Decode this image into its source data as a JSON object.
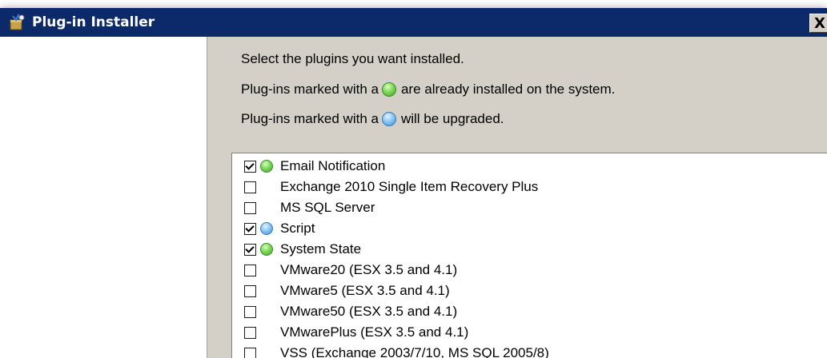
{
  "window": {
    "title": "Plug-in Installer",
    "close_label": "X",
    "title_bar_color": "#0c2a6a"
  },
  "instructions": {
    "line1": "Select the plugins you want installed.",
    "line2_before": "Plug-ins marked with a",
    "line2_after": "are already installed on the system.",
    "line3_before": "Plug-ins marked with a",
    "line3_after": "will be upgraded."
  },
  "plugins": [
    {
      "label": "Email Notification",
      "checked": true,
      "status": "installed"
    },
    {
      "label": "Exchange 2010 Single Item Recovery Plus",
      "checked": false,
      "status": "none"
    },
    {
      "label": "MS SQL Server",
      "checked": false,
      "status": "none"
    },
    {
      "label": "Script",
      "checked": true,
      "status": "upgrade"
    },
    {
      "label": "System State",
      "checked": true,
      "status": "installed"
    },
    {
      "label": "VMware20 (ESX 3.5 and 4.1)",
      "checked": false,
      "status": "none"
    },
    {
      "label": "VMware5 (ESX 3.5 and 4.1)",
      "checked": false,
      "status": "none"
    },
    {
      "label": "VMware50 (ESX 3.5 and 4.1)",
      "checked": false,
      "status": "none"
    },
    {
      "label": "VMwarePlus (ESX 3.5 and 4.1)",
      "checked": false,
      "status": "none"
    },
    {
      "label": "VSS (Exchange 2003/7/10, MS SQL 2005/8)",
      "checked": false,
      "status": "none"
    }
  ],
  "colors": {
    "installed": "#4fbf3a",
    "upgrade": "#5aa8e8"
  }
}
